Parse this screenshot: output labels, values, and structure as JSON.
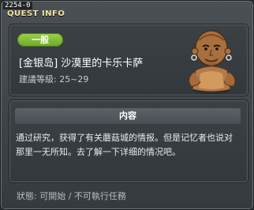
{
  "window": {
    "quest_id": "2254-0",
    "title": "QUEST INFO"
  },
  "quest": {
    "category_badge": "一般",
    "name": "[金银岛] 沙漠里的卡乐卡萨",
    "level_text": "建議等級: 25~29",
    "npc_icon": "bald-old-man-portrait-icon"
  },
  "description": {
    "header": "内容",
    "text": "通过研究，获得了有关蘑菇城的情报。但是记忆者也说对那里一无所知。去了解一下详细的情况吧。"
  },
  "status": {
    "text": "狀態: 可開始 / 不可執行任務"
  },
  "colors": {
    "badge": "#7dba33",
    "title": "#f2e6a3",
    "panel": "#383d41"
  }
}
